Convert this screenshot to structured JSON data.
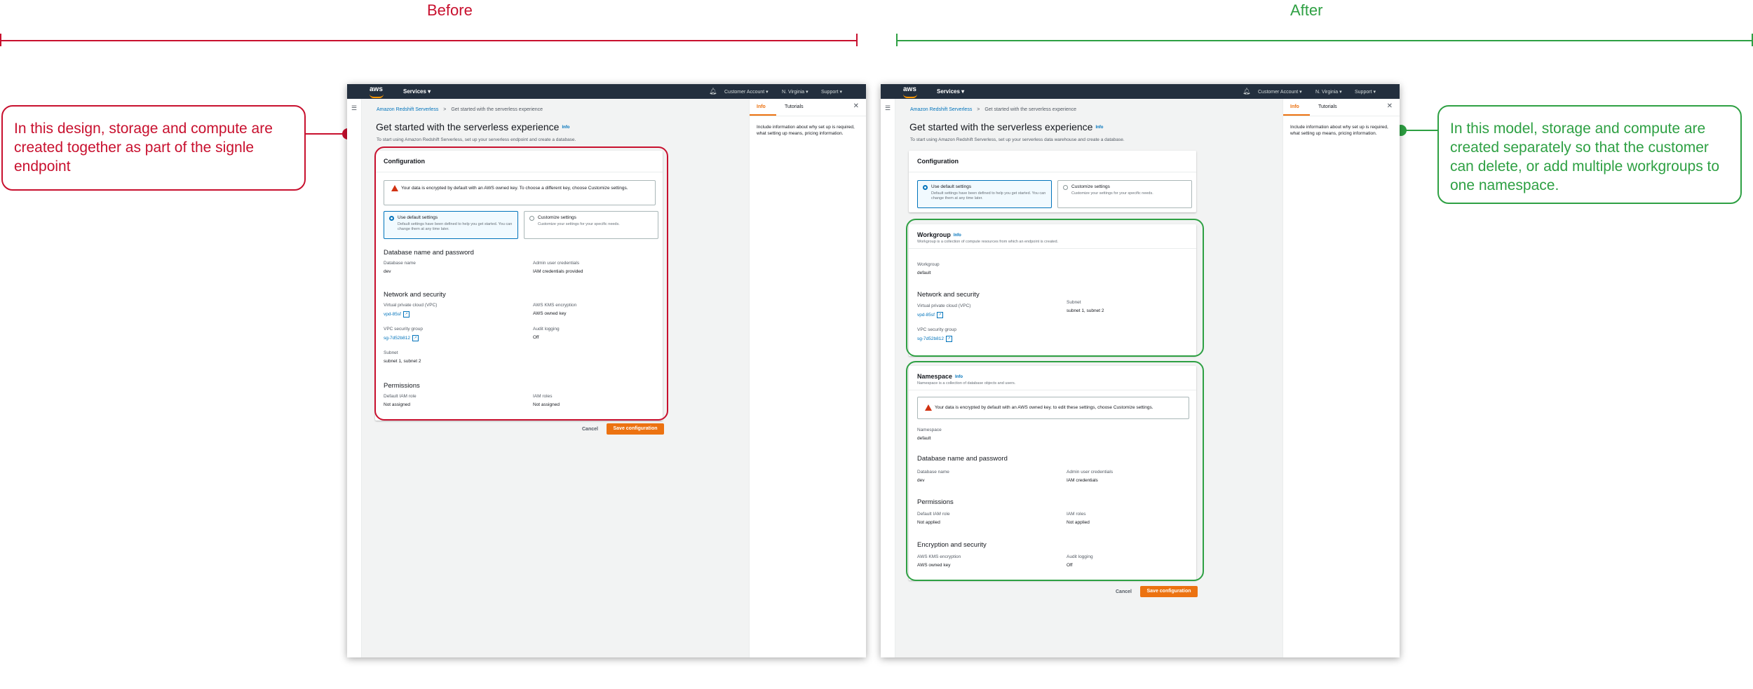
{
  "comparison": {
    "before_label": "Before",
    "after_label": "After",
    "before_color": "#c8102e",
    "after_color": "#2ea043",
    "before_note": "In this design, storage and compute are created together as part of the signle endpoint",
    "after_note": "In this model, storage and compute are created separately so that the customer can delete, or add multiple workgroups to one namespace."
  },
  "nav": {
    "logo": "aws",
    "services": "Services",
    "account": "Customer Account",
    "region": "N. Virginia",
    "support": "Support",
    "bell_icon": "bell-icon",
    "menu_icon": "hamburger-icon"
  },
  "help_panel": {
    "tab_info": "Info",
    "tab_tutorials": "Tutorials",
    "close_icon": "close-icon",
    "text": "Include information about why set up is required, what setting up means, pricing information."
  },
  "before": {
    "breadcrumb_link": "Amazon Redshift Serverless",
    "breadcrumb_sep": ">",
    "breadcrumb_current": "Get started with the serverless experience",
    "title": "Get started with the serverless experience",
    "info": "Info",
    "subtitle": "To start using Amazon Redshift Serverless, set up your serverless endpoint and create a database.",
    "config_title": "Configuration",
    "alert": "Your data is encrypted by default with an AWS owned key. To choose a different key, choose Customize settings.",
    "default_tile_title": "Use default settings",
    "default_tile_desc": "Default settings have been defined to help you get started. You can change them at any time later.",
    "custom_tile_title": "Customize settings",
    "custom_tile_desc": "Customize your settings for your specific needs.",
    "db_section": "Database name and password",
    "db_name_label": "Database name",
    "db_name_value": "dev",
    "admin_label": "Admin user credentials",
    "admin_value": "IAM credentials provided",
    "net_section": "Network and security",
    "vpc_label": "Virtual private cloud (VPC)",
    "vpc_value": "vpd-85sf",
    "kms_label": "AWS KMS encryption",
    "kms_value": "AWS owned key",
    "sg_label": "VPC security group",
    "sg_value": "sg-7d52b812",
    "audit_label": "Audit logging",
    "audit_value": "Off",
    "subnet_label": "Subnet",
    "subnet_value": "subnet 1, subnet 2",
    "perm_section": "Permissions",
    "iam_default_label": "Default IAM role",
    "iam_default_value": "Not assigned",
    "iam_roles_label": "IAM roles",
    "iam_roles_value": "Not assigned",
    "cancel": "Cancel",
    "save": "Save configuration"
  },
  "after": {
    "breadcrumb_link": "Amazon Redshift Serverless",
    "breadcrumb_sep": ">",
    "breadcrumb_current": "Get started with the serverless experience",
    "title": "Get started with the serverless experience",
    "info": "Info",
    "subtitle": "To start using Amazon Redshift Serverless, set up your serverless data warehouse and create a database.",
    "config_title": "Configuration",
    "default_tile_title": "Use default settings",
    "default_tile_desc": "Default settings have been defined to help you get started. You can change them at any time later.",
    "custom_tile_title": "Customize settings",
    "custom_tile_desc": "Customize your settings for your specific needs.",
    "wg_title": "Workgroup",
    "wg_info": "Info",
    "wg_desc": "Workgroup is a collection of compute resources from which an endpoint is created.",
    "wg_label": "Workgroup",
    "wg_value": "default",
    "net_section": "Network and security",
    "vpc_label": "Virtual private cloud (VPC)",
    "vpc_value": "vpd-85sf",
    "subnet_label": "Subnet",
    "subnet_value": "subnet 1, subnet 2",
    "sg_label": "VPC security group",
    "sg_value": "sg-7d52b812",
    "ns_title": "Namespace",
    "ns_info": "Info",
    "ns_desc": "Namespace is a collection of database objects and users.",
    "alert": "Your data is encrypted by default with an AWS owned key. to edit these settings, choose Customize settings.",
    "ns_label": "Namespace",
    "ns_value": "default",
    "db_section": "Database name and password",
    "db_name_label": "Database name",
    "db_name_value": "dev",
    "admin_label": "Admin user credentials",
    "admin_value": "IAM credentials",
    "perm_section": "Permissions",
    "iam_default_label": "Default IAM role",
    "iam_default_value": "Not applied",
    "iam_roles_label": "IAM roles",
    "iam_roles_value": "Not applied",
    "enc_section": "Encryption and security",
    "kms_label": "AWS KMS encryption",
    "kms_value": "AWS owned key",
    "audit_label": "Audit logging",
    "audit_value": "Off",
    "cancel": "Cancel",
    "save": "Save configuration"
  }
}
